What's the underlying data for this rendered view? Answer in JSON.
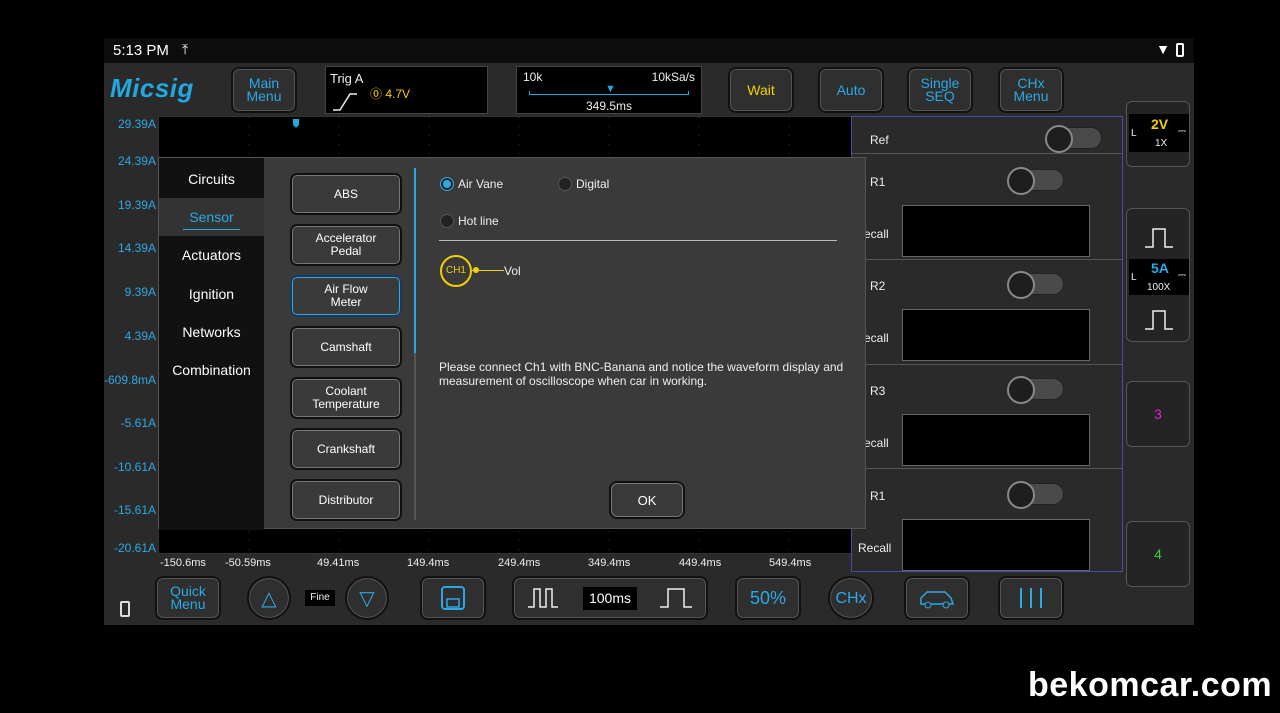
{
  "status_bar": {
    "time": "5:13 PM",
    "upload_icon": "upload-icon",
    "wifi_icon": "wifi-icon",
    "battery_icon": "battery-icon"
  },
  "app": {
    "logo": "Micsig"
  },
  "toolbar": {
    "main_menu": "Main\nMenu",
    "trigger": {
      "label": "Trig A",
      "value": "⓪ 4.7V"
    },
    "timebase": {
      "left": "10k",
      "right": "10kSa/s",
      "center": "349.5ms"
    },
    "wait": "Wait",
    "auto": "Auto",
    "single_seq": "Single\nSEQ",
    "chx_menu": "CHx\nMenu"
  },
  "y_axis_labels": [
    "29.39A",
    "24.39A",
    "19.39A",
    "14.39A",
    "9.39A",
    "4.39A",
    "-609.8mA",
    "-5.61A",
    "-10.61A",
    "-15.61A",
    "-20.61A"
  ],
  "x_axis_labels": [
    "-150.6ms",
    "-50.59ms",
    "49.41ms",
    "149.4ms",
    "249.4ms",
    "349.4ms",
    "449.4ms",
    "549.4ms"
  ],
  "ref_panel": {
    "ref_label": "Ref",
    "rows": [
      {
        "label": "R1",
        "recall": "ecall"
      },
      {
        "label": "R2",
        "recall": "ecall"
      },
      {
        "label": "R3",
        "recall": "ecall"
      },
      {
        "label": "R1",
        "recall": "Recall"
      }
    ]
  },
  "channels": {
    "ch1": {
      "prefix": "L",
      "scale": "2V",
      "probe": "1X"
    },
    "ch2": {
      "prefix": "L",
      "scale": "5A",
      "probe": "100X"
    },
    "ch3": "3",
    "ch4": "4"
  },
  "bottom_toolbar": {
    "quick_menu": "Quick\nMenu",
    "fine": "Fine",
    "timebase": "100ms",
    "fifty": "50%",
    "chx": "CHx"
  },
  "dialog": {
    "categories": [
      "Circuits",
      "Sensor",
      "Actuators",
      "Ignition",
      "Networks",
      "Combination"
    ],
    "active_category": "Sensor",
    "sensors": [
      "ABS",
      "Accelerator\nPedal",
      "Air Flow\nMeter",
      "Camshaft",
      "Coolant\nTemperature",
      "Crankshaft",
      "Distributor"
    ],
    "selected_sensor": "Air Flow Meter",
    "options": {
      "air_vane": "Air Vane",
      "digital": "Digital",
      "hot_line": "Hot line",
      "selected": "Air Vane"
    },
    "probe": {
      "channel": "CH1",
      "signal": "Vol"
    },
    "description": "Please connect Ch1 with BNC-Banana and notice the waveform display and measurement of oscilloscope when car in working.",
    "ok": "OK"
  },
  "watermark": "bekomcar.com",
  "colors": {
    "accent": "#2aa9e6",
    "yellow": "#f4d000",
    "magenta": "#e020d0",
    "green": "#30d040"
  }
}
